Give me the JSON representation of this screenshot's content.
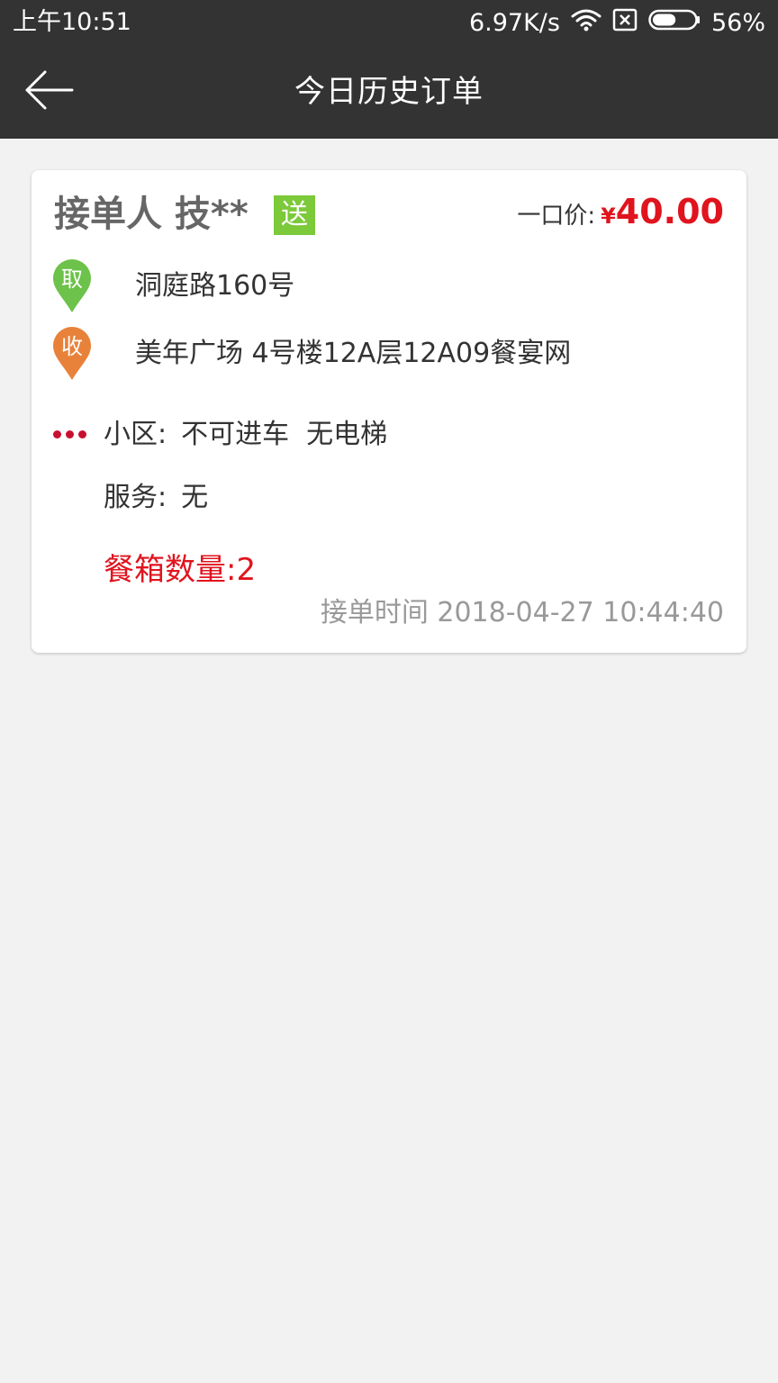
{
  "status_bar": {
    "time": "上午10:51",
    "network_speed": "6.97K/s",
    "battery_percent": "56%",
    "battery_level": 0.56,
    "icons": [
      "wifi-icon",
      "sim-x-icon",
      "battery-icon"
    ]
  },
  "app_bar": {
    "title": "今日历史订单",
    "back_icon": "back-arrow-icon"
  },
  "order": {
    "receiver_label": "接单人 技**",
    "tag": "送",
    "price_label": "一口价:",
    "price_currency": "¥",
    "price_value": "40.00",
    "pickup_badge": "取",
    "pickup_address": "洞庭路160号",
    "dropoff_badge": "收",
    "dropoff_address": "美年广场 4号楼12A层12A09餐宴网",
    "community_label": "小区:",
    "community_value": "不可进车  无电梯",
    "service_label": "服务:",
    "service_value": "无",
    "box_count_label": "餐箱数量:",
    "box_count_value": "2",
    "accept_time": "接单时间 2018-04-27 10:44:40"
  },
  "colors": {
    "header_bg": "#333333",
    "page_bg": "#f2f2f2",
    "price_red": "#e0141e",
    "tag_green": "#7cc93a",
    "pickup_green": "#6cc24a",
    "dropoff_orange": "#e8823a",
    "dot_red": "#c8102e"
  }
}
